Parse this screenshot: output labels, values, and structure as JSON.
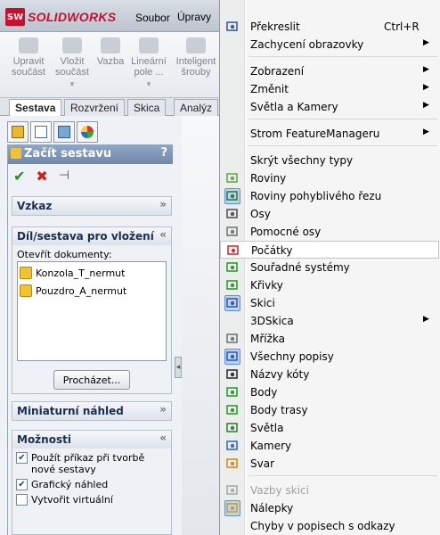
{
  "app": {
    "logo_mark": "SW",
    "logo_text": "SOLIDWORKS",
    "menus": [
      "Soubor",
      "Úpravy"
    ]
  },
  "ribbon": {
    "items": [
      {
        "line1": "Upravit",
        "line2": "součást",
        "icon": "edit-component-icon"
      },
      {
        "line1": "Vložit",
        "line2": "součást",
        "icon": "insert-component-icon"
      },
      {
        "line1": "Vazba",
        "line2": "",
        "icon": "mate-icon"
      },
      {
        "line1": "Lineární",
        "line2": "pole ...",
        "icon": "linear-pattern-icon"
      },
      {
        "line1": "Inteligent",
        "line2": "šrouby",
        "icon": "smart-fasteners-icon"
      }
    ]
  },
  "command_tabs": [
    "Sestava",
    "Rozvržení",
    "Skica",
    "Analýz"
  ],
  "property_manager": {
    "title": "Začít sestavu",
    "help": "?",
    "ok_symbol": "✔",
    "cancel_symbol": "✖",
    "pin_symbol": "⊣",
    "groups": {
      "vzkaz": "Vzkaz",
      "dil": "Díl/sestava pro vložení",
      "open_docs_label": "Otevřít dokumenty:",
      "docs": [
        "Konzola_T_nermut",
        "Pouzdro_A_nermut"
      ],
      "browse": "Procházet...",
      "preview": "Miniaturní náhled",
      "options": "Možnosti",
      "opt1": "Použít příkaz při tvorbě nové sestavy",
      "opt1_checked": true,
      "opt2": "Grafický náhled",
      "opt2_checked": true,
      "opt3": "Vytvořit virtuální",
      "opt3_checked": false
    }
  },
  "context_menu": {
    "items": [
      {
        "label": "Překreslit",
        "shortcut": "Ctrl+R",
        "icon": "redraw-icon"
      },
      {
        "label": "Zachycení obrazovky",
        "submenu": true
      },
      {
        "label": "Zobrazení",
        "submenu": true
      },
      {
        "label": "Změnit",
        "submenu": true
      },
      {
        "label": "Světla a Kamery",
        "submenu": true
      },
      {
        "label": "Strom FeatureManageru",
        "submenu": true
      },
      {
        "label": "Skrýt všechny typy"
      },
      {
        "label": "Roviny",
        "icon": "plane-icon"
      },
      {
        "label": "Roviny pohyblivého řezu",
        "icon": "section-plane-icon",
        "checked": true
      },
      {
        "label": "Osy",
        "icon": "axis-icon"
      },
      {
        "label": "Pomocné osy",
        "icon": "temp-axis-icon"
      },
      {
        "label": "Počátky",
        "icon": "origin-icon",
        "hover": true
      },
      {
        "label": "Souřadné systémy",
        "icon": "coordinate-system-icon"
      },
      {
        "label": "Křivky",
        "icon": "curve-icon"
      },
      {
        "label": "Skici",
        "icon": "sketch-icon",
        "checked": true
      },
      {
        "label": "3DSkica",
        "submenu": true
      },
      {
        "label": "Mřížka",
        "icon": "grid-icon"
      },
      {
        "label": "Všechny popisy",
        "icon": "annotation-icon",
        "checked": true
      },
      {
        "label": "Názvy kóty",
        "icon": "dimension-name-icon"
      },
      {
        "label": "Body",
        "icon": "point-icon"
      },
      {
        "label": "Body trasy",
        "icon": "route-point-icon"
      },
      {
        "label": "Světla",
        "icon": "light-icon"
      },
      {
        "label": "Kamery",
        "icon": "camera-icon"
      },
      {
        "label": "Svar",
        "icon": "weld-icon"
      },
      {
        "label": "Vazby skici",
        "icon": "sketch-relation-icon",
        "disabled": true
      },
      {
        "label": "Nálepky",
        "icon": "decal-icon",
        "checked": true
      },
      {
        "label": "Chyby v popisech s odkazy"
      }
    ]
  }
}
